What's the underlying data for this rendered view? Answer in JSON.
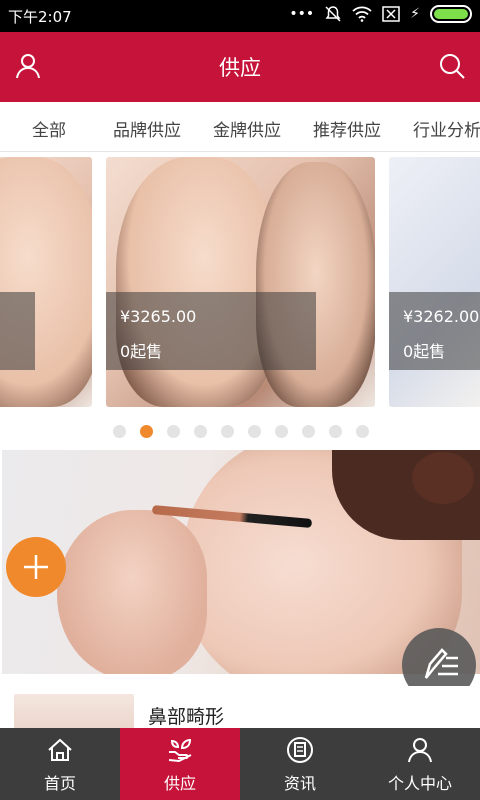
{
  "status_bar": {
    "time": "下午2:07"
  },
  "header": {
    "title": "供应"
  },
  "tabs": [
    "全部",
    "品牌供应",
    "金牌供应",
    "推荐供应",
    "行业分析"
  ],
  "carousel": {
    "cards": [
      {
        "price": "",
        "moq": ""
      },
      {
        "price": "¥3265.00",
        "moq": "0起售"
      },
      {
        "price": "¥3262.00",
        "moq": "0起售"
      }
    ],
    "active_dot": 1,
    "dot_count": 10
  },
  "list": {
    "first_item_name": "鼻部畸形"
  },
  "bottom_nav": [
    {
      "label": "首页",
      "icon": "home-icon"
    },
    {
      "label": "供应",
      "icon": "supply-icon"
    },
    {
      "label": "资讯",
      "icon": "news-icon"
    },
    {
      "label": "个人中心",
      "icon": "person-icon"
    }
  ],
  "colors": {
    "brand": "#c5133a",
    "accent": "#f0892c",
    "nav_bg": "#3d3d3d"
  }
}
